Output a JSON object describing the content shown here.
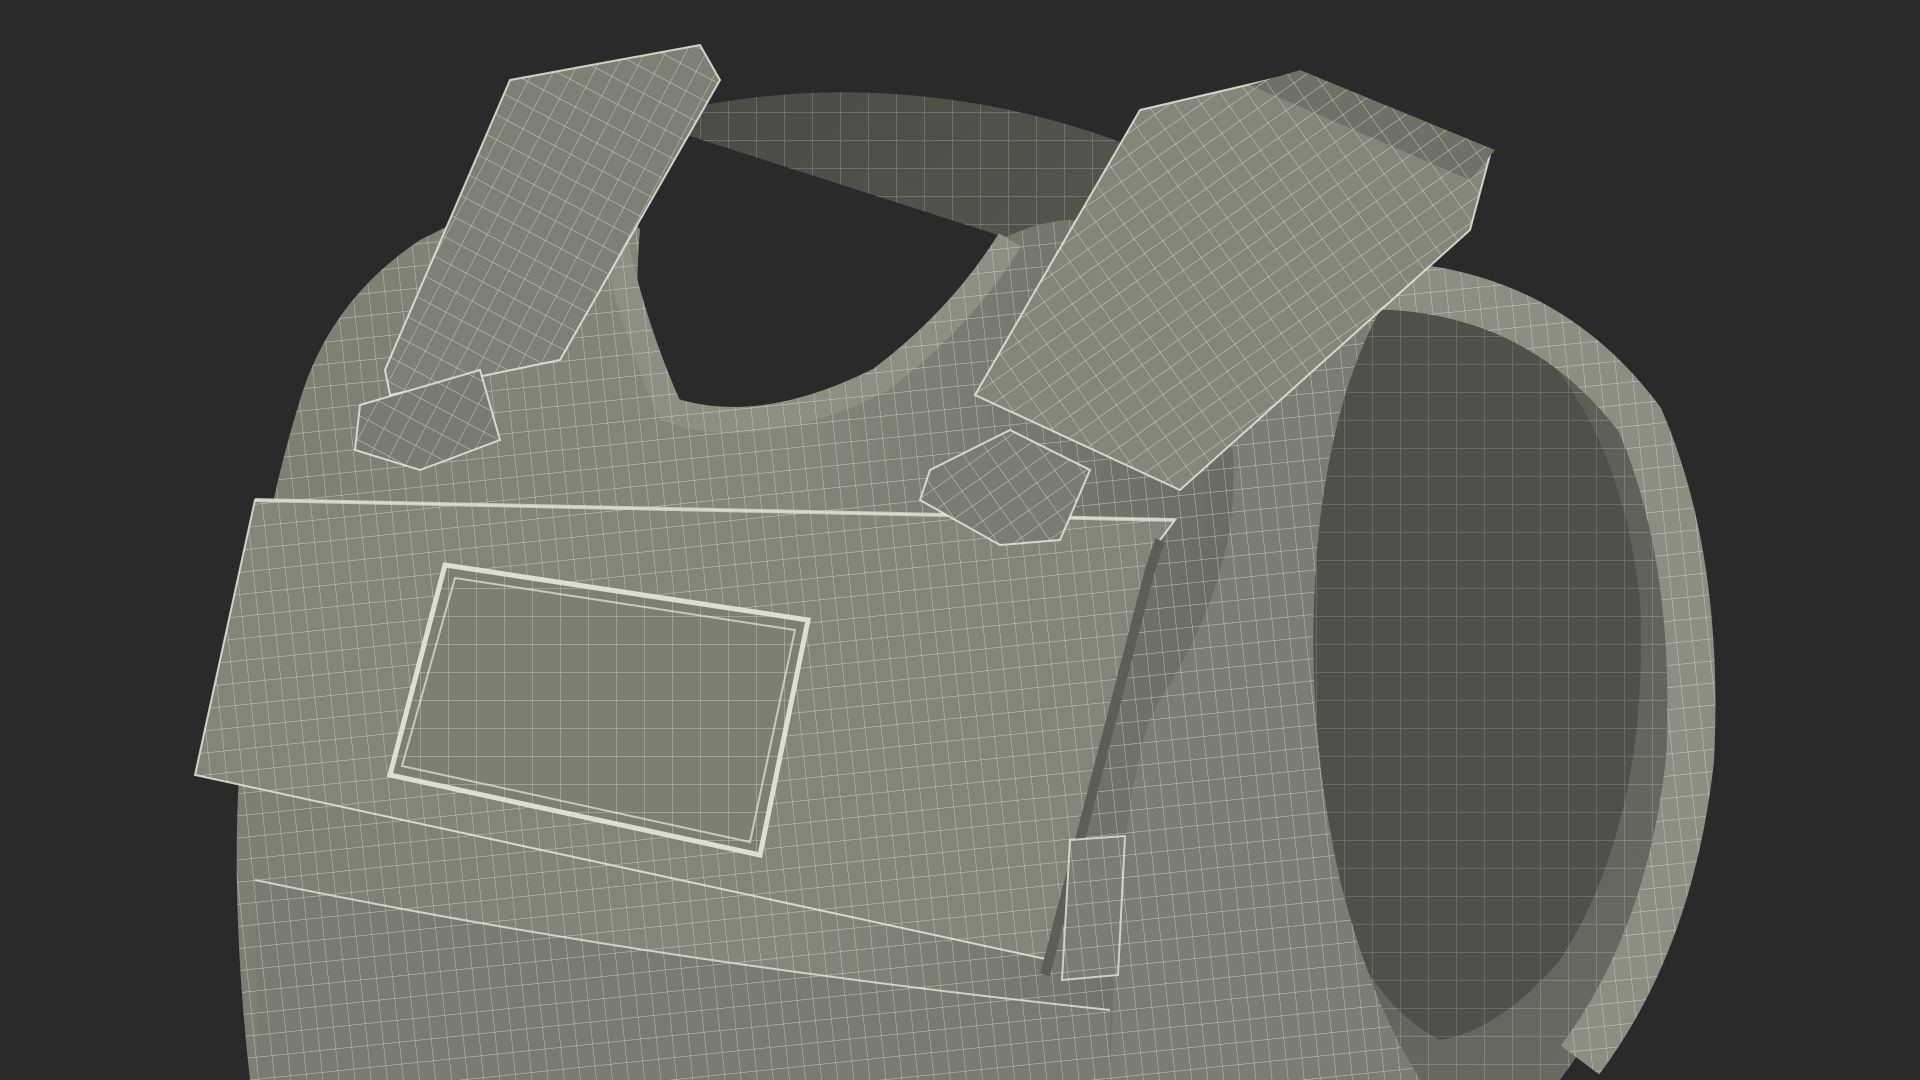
{
  "scene": {
    "background_color": "#2a2a2a",
    "vest_shade_light": "#8a8b7e",
    "vest_shade_mid": "#74756a",
    "vest_shade_dark": "#54554d",
    "interior_shade": "#5f6058",
    "wire_color": "#e6e6da"
  }
}
